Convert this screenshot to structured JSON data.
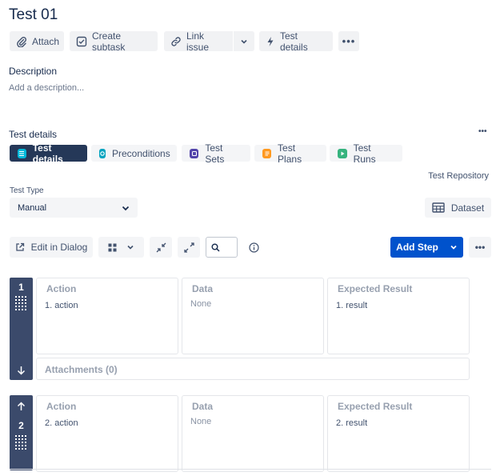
{
  "issue": {
    "title": "Test 01"
  },
  "toolbar": {
    "attach": "Attach",
    "create_subtask": "Create subtask",
    "link_issue": "Link issue",
    "test_details": "Test details"
  },
  "description": {
    "label": "Description",
    "placeholder": "Add a description..."
  },
  "test_details_section": {
    "label": "Test details",
    "tabs": [
      {
        "label": "Test details",
        "active": true,
        "icon": "list-icon",
        "color": "#00b8d9"
      },
      {
        "label": "Preconditions",
        "active": false,
        "icon": "precondition-icon",
        "color": "#00a3bf"
      },
      {
        "label": "Test Sets",
        "active": false,
        "icon": "test-set-icon",
        "color": "#5243aa"
      },
      {
        "label": "Test Plans",
        "active": false,
        "icon": "test-plan-icon",
        "color": "#ff991f"
      },
      {
        "label": "Test Runs",
        "active": false,
        "icon": "test-run-icon",
        "color": "#36b37e"
      }
    ],
    "repository_link": "Test Repository",
    "test_type_label": "Test Type",
    "test_type_value": "Manual",
    "dataset_button": "Dataset"
  },
  "steps_toolbar": {
    "edit_in_dialog": "Edit in Dialog",
    "add_step": "Add Step",
    "accent": "#0052cc"
  },
  "steps": [
    {
      "number": "1",
      "action_header": "Action",
      "action": "1. action",
      "data_header": "Data",
      "data": "None",
      "expected_header": "Expected Result",
      "expected": "1. result",
      "attachments": "Attachments (0)"
    },
    {
      "number": "2",
      "action_header": "Action",
      "action": "2. action",
      "data_header": "Data",
      "data": "None",
      "expected_header": "Expected Result",
      "expected": "2. result"
    }
  ]
}
